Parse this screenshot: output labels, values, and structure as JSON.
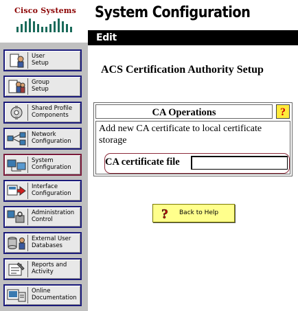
{
  "brand": {
    "logo_text": "Cisco Systems"
  },
  "header": {
    "title": "System Configuration",
    "edit_label": "Edit"
  },
  "sidebar": {
    "items": [
      {
        "label": "User\nSetup",
        "icon": "user-setup-icon"
      },
      {
        "label": "Group\nSetup",
        "icon": "group-setup-icon"
      },
      {
        "label": "Shared Profile\nComponents",
        "icon": "shared-profile-icon"
      },
      {
        "label": "Network\nConfiguration",
        "icon": "network-config-icon"
      },
      {
        "label": "System\nConfiguration",
        "icon": "system-config-icon",
        "active": true
      },
      {
        "label": "Interface\nConfiguration",
        "icon": "interface-config-icon"
      },
      {
        "label": "Administration\nControl",
        "icon": "admin-control-icon"
      },
      {
        "label": "External User\nDatabases",
        "icon": "external-db-icon"
      },
      {
        "label": "Reports and\nActivity",
        "icon": "reports-icon"
      },
      {
        "label": "Online\nDocumentation",
        "icon": "documentation-icon"
      }
    ]
  },
  "main": {
    "section_title": "ACS Certification Authority Setup",
    "ca_operations": {
      "header": "CA Operations",
      "help_glyph": "?",
      "description": "Add new CA certificate to local certificate storage",
      "cert_file_label": "CA certificate file",
      "cert_file_value": ""
    },
    "back_to_help": "Back to Help"
  },
  "colors": {
    "sidebar_bg": "#c0c0c0",
    "edit_bar": "#000000",
    "nav_border": "#1a1a7a",
    "active_nav_border": "#7a1a3a",
    "help_yellow": "#ffeb3b",
    "back_help_bg": "#ffff8c",
    "logo_red": "#8b0000"
  }
}
